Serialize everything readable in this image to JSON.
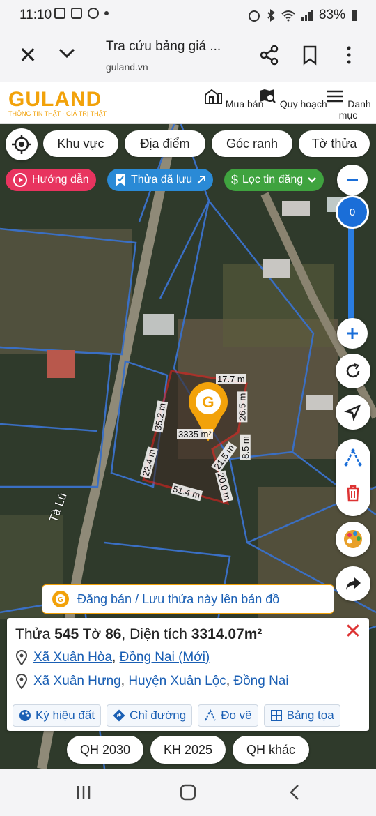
{
  "status": {
    "time": "11:10",
    "battery": "83%"
  },
  "browser": {
    "title": "Tra cứu bảng giá ...",
    "url": "guland.vn"
  },
  "header": {
    "logo_word": "GULAND",
    "logo_tagline": "THÔNG TIN THẬT - GIÁ TRỊ THẬT",
    "nav": [
      "Mua bán",
      "Quy hoạch",
      "Danh mục"
    ]
  },
  "filters": [
    "Khu vực",
    "Địa điểm",
    "Góc ranh",
    "Tờ thửa"
  ],
  "pills": {
    "guide": "Hướng dẫn",
    "saved": "Thửa đã lưu",
    "filter": "Lọc tin đăng"
  },
  "zoom": {
    "level": "0"
  },
  "map": {
    "road_label": "Tà Lú",
    "area_label": "3335 m²",
    "edges": [
      "17.7 m",
      "26.5 m",
      "8.5 m",
      "21.5 m",
      "20.0 m",
      "51.4 m",
      "22.4 m",
      "35.2 m"
    ]
  },
  "post_banner": "Đăng bán / Lưu thửa này lên bản đồ",
  "parcel": {
    "label_thua": "Thửa",
    "thua": "545",
    "label_to": "Tờ",
    "to": "86",
    "label_area": "Diện tích",
    "area": "3314.07m²",
    "addr1_a": "Xã Xuân Hòa",
    "addr1_b": "Đồng Nai (Mới)",
    "addr2_a": "Xã Xuân Hưng",
    "addr2_b": "Huyện Xuân Lộc",
    "addr2_c": "Đồng Nai"
  },
  "tools": [
    "Ký hiệu đất",
    "Chỉ đường",
    "Đo vẽ",
    "Bảng tọa"
  ],
  "plans": [
    "QH 2030",
    "KH 2025",
    "QH khác"
  ],
  "colors": {
    "accent": "#f2a20a",
    "link": "#1a5fb4",
    "guide_pill": "#e8345f",
    "saved_pill": "#2a8ad6",
    "filter_pill": "#3fa33f",
    "zoom": "#1a6ed8"
  }
}
